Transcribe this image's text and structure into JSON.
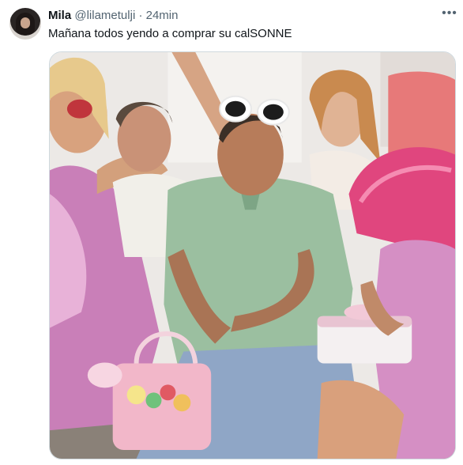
{
  "tweet": {
    "author_name": "Mila",
    "author_handle": "@lilametulji",
    "separator": "·",
    "timestamp": "24min",
    "text": "Mañana todos yendo a comprar su calSONNE",
    "more_icon": "more-horizontal-icon"
  },
  "media": {
    "kind": "photo",
    "content": "group of people seated, man in white sunglasses and green polo holding a pink basket, women in pink metallic outfits"
  },
  "colors": {
    "text_primary": "#0f1419",
    "text_secondary": "#536471",
    "media_border": "#cfd9de"
  }
}
